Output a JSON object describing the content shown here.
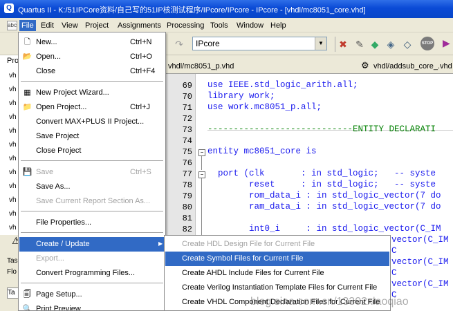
{
  "window": {
    "title": "Quartus II - K:/51IPCore资料/自己写的51IP核测试程序/IPcore/IPcore - IPcore - [vhdl/mc8051_core.vhd]",
    "logo": "Q"
  },
  "menubar": {
    "items": [
      "File",
      "Edit",
      "View",
      "Project",
      "Assignments",
      "Processing",
      "Tools",
      "Window",
      "Help"
    ]
  },
  "toolbar": {
    "project_combo": "IPcore",
    "stop_label": "STOP"
  },
  "project_pane": {
    "label": "Pro",
    "rows": [
      "vh",
      "vh",
      "vh",
      "vh",
      "vh",
      "vh",
      "vh",
      "vh",
      "vh",
      "vh",
      "vh",
      "vh"
    ],
    "tasks_label": "Tas",
    "flow_label": "Flo",
    "task_box": "Ta"
  },
  "tabs": [
    {
      "label": "vhdl/mc8051_p.vhd"
    },
    {
      "label": "vhdl/addsub_core_.vhd"
    }
  ],
  "editor": {
    "lines": [
      {
        "no": "69",
        "text": "use IEEE.std_logic_arith.all;"
      },
      {
        "no": "70",
        "text": "library work;"
      },
      {
        "no": "71",
        "text": "use work.mc8051_p.all;"
      },
      {
        "no": "72",
        "text": ""
      },
      {
        "no": "73",
        "text": "----------------------------ENTITY DECLARATI"
      },
      {
        "no": "74",
        "text": ""
      },
      {
        "no": "75",
        "text": "entity mc8051_core is"
      },
      {
        "no": "76",
        "text": ""
      },
      {
        "no": "77",
        "text": "  port (clk       : in std_logic;   -- syste"
      },
      {
        "no": "78",
        "text": "        reset     : in std_logic;   -- syste"
      },
      {
        "no": "79",
        "text": "        rom_data_i : in std_logic_vector(7 do"
      },
      {
        "no": "80",
        "text": "        ram_data_i : in std_logic_vector(7 do"
      },
      {
        "no": "81",
        "text": ""
      },
      {
        "no": "82",
        "text": "        int0_i     : in std_logic_vector(C_IM"
      }
    ],
    "partial_right": [
      "vector(C_IM",
      "C",
      "vector(C_IM",
      "C",
      "vector(C_IM",
      "C"
    ]
  },
  "file_menu": {
    "items": [
      {
        "label": "New...",
        "shortcut": "Ctrl+N",
        "icon": "new-file-icon",
        "glyph": "🗋",
        "disabled": false
      },
      {
        "label": "Open...",
        "shortcut": "Ctrl+O",
        "icon": "open-folder-icon",
        "glyph": "📂",
        "disabled": false
      },
      {
        "label": "Close",
        "shortcut": "Ctrl+F4",
        "icon": "",
        "glyph": "",
        "disabled": false
      },
      {
        "label": "New Project Wizard...",
        "shortcut": "",
        "icon": "wizard-icon",
        "glyph": "▦",
        "disabled": false
      },
      {
        "label": "Open Project...",
        "shortcut": "Ctrl+J",
        "icon": "open-project-icon",
        "glyph": "📁",
        "disabled": false
      },
      {
        "label": "Convert MAX+PLUS II Project...",
        "shortcut": "",
        "icon": "",
        "glyph": "",
        "disabled": false
      },
      {
        "label": "Save Project",
        "shortcut": "",
        "icon": "",
        "glyph": "",
        "disabled": false
      },
      {
        "label": "Close Project",
        "shortcut": "",
        "icon": "",
        "glyph": "",
        "disabled": false
      },
      {
        "label": "Save",
        "shortcut": "Ctrl+S",
        "icon": "save-disk-icon",
        "glyph": "💾",
        "disabled": true
      },
      {
        "label": "Save As...",
        "shortcut": "",
        "icon": "",
        "glyph": "",
        "disabled": false
      },
      {
        "label": "Save Current Report Section As...",
        "shortcut": "",
        "icon": "",
        "glyph": "",
        "disabled": true
      },
      {
        "label": "File Properties...",
        "shortcut": "",
        "icon": "",
        "glyph": "",
        "disabled": false
      },
      {
        "label": "Create / Update",
        "shortcut": "",
        "icon": "",
        "glyph": "",
        "disabled": false,
        "submenu": true,
        "hover": true
      },
      {
        "label": "Export...",
        "shortcut": "",
        "icon": "",
        "glyph": "",
        "disabled": true
      },
      {
        "label": "Convert Programming Files...",
        "shortcut": "",
        "icon": "",
        "glyph": "",
        "disabled": false
      },
      {
        "label": "Page Setup...",
        "shortcut": "",
        "icon": "page-setup-icon",
        "glyph": "🗐",
        "disabled": false
      },
      {
        "label": "Print Preview",
        "shortcut": "",
        "icon": "print-preview-icon",
        "glyph": "🔍",
        "disabled": false
      }
    ]
  },
  "submenu": {
    "items": [
      {
        "label": "Create HDL Design File for Current File",
        "disabled": true
      },
      {
        "label": "Create Symbol Files for Current File",
        "disabled": false,
        "hover": true
      },
      {
        "label": "Create AHDL Include Files for Current File",
        "disabled": false
      },
      {
        "label": "Create Verilog Instantiation Template Files for Current File",
        "disabled": false
      },
      {
        "label": "Create VHDL Component Declaration Files for Current File",
        "disabled": false
      }
    ]
  },
  "watermark": "blog.sina.com.cn/13302xiaoqiao",
  "colors": {
    "titlebar": "#0a4ad6",
    "menu_highlight": "#316ac5",
    "keyword": "#1a1aee",
    "comment": "#008000",
    "disabled_text": "#a2a2a2"
  }
}
